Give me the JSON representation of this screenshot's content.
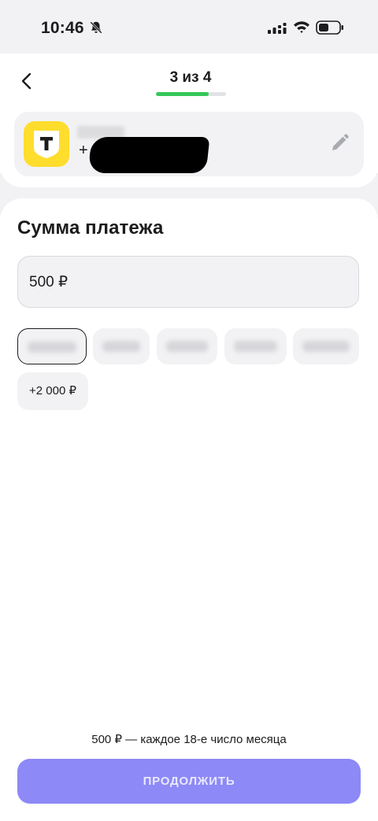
{
  "status_bar": {
    "time": "10:46",
    "icons": [
      "bell-slash-icon",
      "signal-icon",
      "wifi-icon",
      "battery-icon"
    ]
  },
  "header": {
    "back_icon": "chevron-left-icon",
    "step_label": "3 из 4",
    "step_progress": 0.75,
    "colors": {
      "progress": "#34c759"
    }
  },
  "recipient": {
    "bank_logo_icon": "tbank-logo-icon",
    "name": "",
    "phone": "+",
    "edit_icon": "pencil-icon",
    "colors": {
      "logo": "#ffdd2d"
    }
  },
  "payment": {
    "title": "Сумма платежа",
    "amount_value": "500 ₽",
    "quick_chips": [
      "",
      "",
      "",
      "",
      "",
      "+2 000 ₽"
    ],
    "selected_chip_index": 0
  },
  "footer": {
    "schedule_note": "500 ₽ — каждое 18-е число месяца",
    "continue_label": "ПРОДОЛЖИТЬ",
    "colors": {
      "button": "#8d89f6"
    }
  }
}
